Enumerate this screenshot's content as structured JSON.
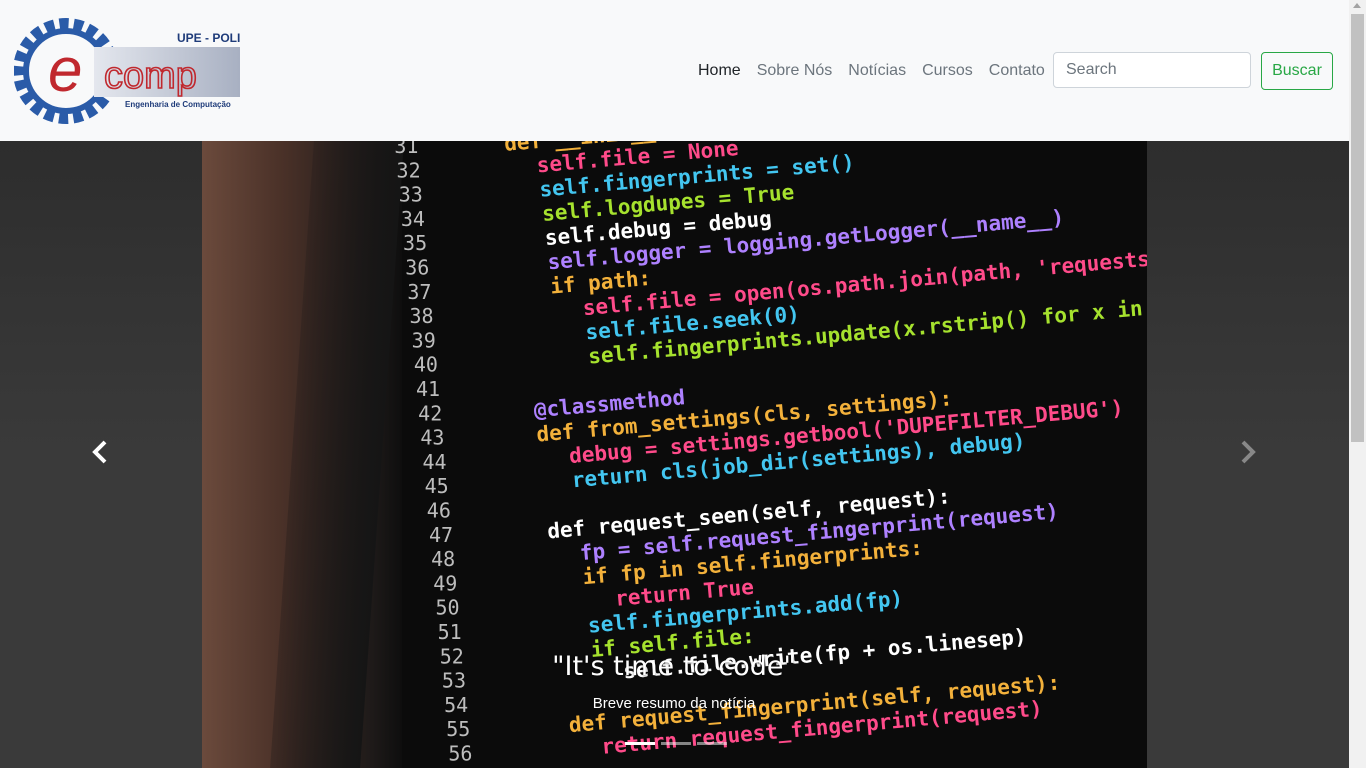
{
  "brand": {
    "logo_top_text": "UPE - POLI",
    "logo_main_text": "comp",
    "logo_letter": "e",
    "logo_sub_text": "Engenharia de Computação",
    "colors": {
      "gear": "#2a5ba8",
      "letter": "#c0282e",
      "panel": "#c9ced8"
    }
  },
  "nav": {
    "items": [
      {
        "label": "Home",
        "active": true
      },
      {
        "label": "Sobre Nós"
      },
      {
        "label": "Notícias"
      },
      {
        "label": "Cursos"
      },
      {
        "label": "Contato"
      }
    ]
  },
  "search": {
    "placeholder": "Search",
    "button_label": "Buscar",
    "button_color": "#28a745"
  },
  "carousel": {
    "caption_title": "\"It's time to code\"",
    "caption_text": "Breve resumo da notícia",
    "indicators_count": 3,
    "active_index": 0,
    "prev_icon": "chevron-left-icon",
    "next_icon": "chevron-right-icon"
  },
  "code_lines": [
    {
      "n": "31",
      "t": "def __init__(self, path=None, debug=False):"
    },
    {
      "n": "32",
      "t": "self.file = None"
    },
    {
      "n": "33",
      "t": "self.fingerprints = set()"
    },
    {
      "n": "34",
      "t": "self.logdupes = True"
    },
    {
      "n": "35",
      "t": "self.debug = debug"
    },
    {
      "n": "36",
      "t": "self.logger = logging.getLogger(__name__)"
    },
    {
      "n": "37",
      "t": "if path:"
    },
    {
      "n": "38",
      "t": "self.file = open(os.path.join(path, 'requests.seen'), 'a+')"
    },
    {
      "n": "39",
      "t": "self.file.seek(0)"
    },
    {
      "n": "40",
      "t": "self.fingerprints.update(x.rstrip() for x in self.file)"
    },
    {
      "n": "41",
      "t": ""
    },
    {
      "n": "42",
      "t": "@classmethod"
    },
    {
      "n": "43",
      "t": "def from_settings(cls, settings):"
    },
    {
      "n": "44",
      "t": "debug = settings.getbool('DUPEFILTER_DEBUG')"
    },
    {
      "n": "45",
      "t": "return cls(job_dir(settings), debug)"
    },
    {
      "n": "46",
      "t": ""
    },
    {
      "n": "47",
      "t": "def request_seen(self, request):"
    },
    {
      "n": "48",
      "t": "fp = self.request_fingerprint(request)"
    },
    {
      "n": "49",
      "t": "if fp in self.fingerprints:"
    },
    {
      "n": "50",
      "t": "return True"
    },
    {
      "n": "51",
      "t": "self.fingerprints.add(fp)"
    },
    {
      "n": "52",
      "t": "if self.file:"
    },
    {
      "n": "53",
      "t": "self.file.write(fp + os.linesep)"
    },
    {
      "n": "54",
      "t": ""
    },
    {
      "n": "55",
      "t": "def request_fingerprint(self, request):"
    },
    {
      "n": "56",
      "t": "return request_fingerprint(request)"
    }
  ]
}
